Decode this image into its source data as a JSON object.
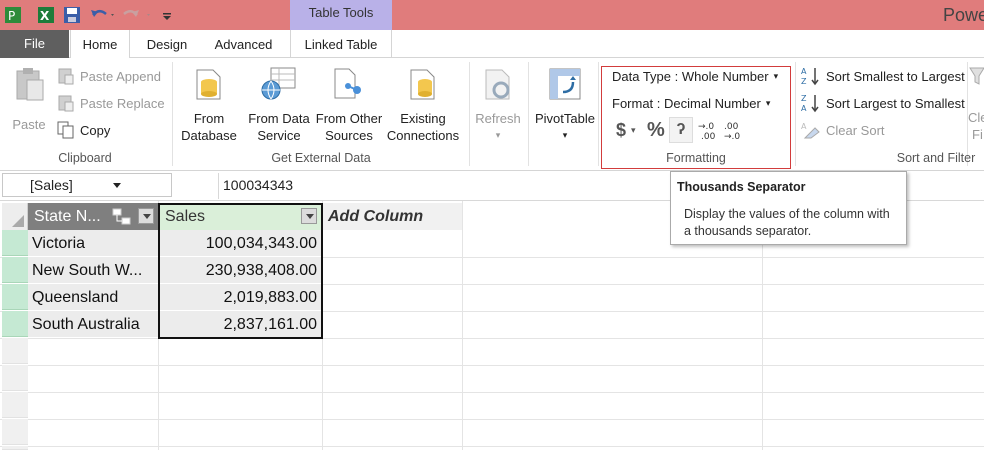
{
  "titlebar": {
    "contextual_label": "Table Tools",
    "app_title": "Powe",
    "colors": {
      "titlebar": "#e07c7c",
      "contextual": "#b9b1e8"
    }
  },
  "tabs": [
    {
      "label": "File"
    },
    {
      "label": "Home"
    },
    {
      "label": "Design"
    },
    {
      "label": "Advanced"
    },
    {
      "label": "Linked Table"
    }
  ],
  "ribbon": {
    "clipboard": {
      "label": "Clipboard",
      "paste": "Paste",
      "paste_append": "Paste Append",
      "paste_replace": "Paste Replace",
      "copy": "Copy"
    },
    "external": {
      "label": "Get External Data",
      "from_database_1": "From",
      "from_database_2": "Database",
      "from_data_service_1": "From Data",
      "from_data_service_2": "Service",
      "from_other_1": "From Other",
      "from_other_2": "Sources",
      "existing_1": "Existing",
      "existing_2": "Connections"
    },
    "refresh": {
      "label": "Refresh"
    },
    "pivot": {
      "label": "PivotTable"
    },
    "formatting": {
      "label": "Formatting",
      "data_type": "Data Type : Whole Number",
      "format": "Format : Decimal Number",
      "currency_symbol": "$",
      "percent_symbol": "%",
      "comma_symbol": "ʔ"
    },
    "sort": {
      "label": "Sort and Filter",
      "smallest": "Sort Smallest to Largest",
      "largest": "Sort Largest to Smallest",
      "clear": "Clear Sort",
      "clear_filters_1": "Cle",
      "clear_filters_2": "Fi"
    }
  },
  "formula_bar": {
    "name_box": "[Sales]",
    "value": "100034343"
  },
  "table": {
    "headers": [
      "State N...",
      "Sales",
      "Add Column"
    ],
    "rows": [
      {
        "state": "Victoria",
        "sales": "100,034,343.00"
      },
      {
        "state": "New South W...",
        "sales": "230,938,408.00"
      },
      {
        "state": "Queensland",
        "sales": "2,019,883.00"
      },
      {
        "state": "South Australia",
        "sales": "2,837,161.00"
      }
    ]
  },
  "tooltip": {
    "title": "Thousands Separator",
    "body": "Display the values of the column with a thousands separator."
  }
}
